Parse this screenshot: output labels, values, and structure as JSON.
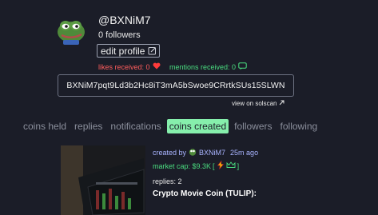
{
  "profile": {
    "username": "@BXNiM7",
    "followers": "0 followers",
    "edit_label": "edit profile",
    "likes": "likes received: 0",
    "mentions": "mentions received: 0",
    "address": "BXNiM7pqt9Ld3b2Hc8iT3mA5bSwoe9CRrtkSUs15SLWN",
    "solscan": "view on solscan"
  },
  "tabs": [
    {
      "label": "coins held"
    },
    {
      "label": "replies"
    },
    {
      "label": "notifications"
    },
    {
      "label": "coins created",
      "active": true
    },
    {
      "label": "followers"
    },
    {
      "label": "following"
    }
  ],
  "coin": {
    "created_by": "created by",
    "creator": "BXNiM7",
    "age": "25m ago",
    "market_cap": "market cap: $9.3K",
    "replies": "replies: 2",
    "title": "Crypto Movie Coin (TULIP):"
  },
  "colors": {
    "background": "#1b1d28",
    "active_tab": "#86efac",
    "likes": "#ff5d5d",
    "mentions": "#4ade80",
    "creator_link": "#a9b4ff"
  }
}
